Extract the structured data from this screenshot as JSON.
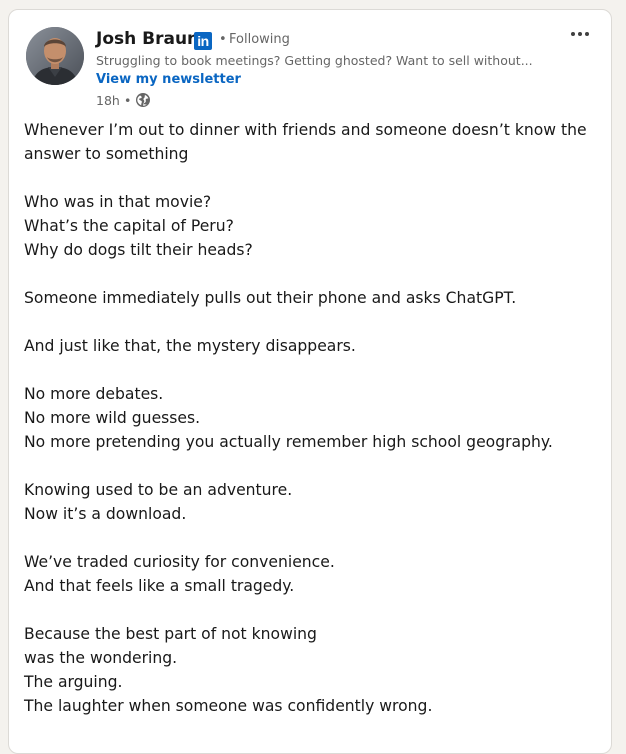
{
  "post": {
    "author": {
      "name": "Josh Braun",
      "badge": "in",
      "follow_status": "Following",
      "headline": "Struggling to book meetings? Getting ghosted? Want to sell without...",
      "newsletter_link": "View my newsletter",
      "timestamp": "18h",
      "visibility_icon": "globe-icon"
    },
    "menu_icon": "more-horizontal-icon",
    "body": [
      "Whenever I’m out to dinner with friends and someone doesn’t know the answer to something",
      "",
      "Who was in that movie?",
      "What’s the capital of Peru?",
      "Why do dogs tilt their heads?",
      "",
      "Someone immediately pulls out their phone and asks ChatGPT.",
      "",
      "And just like that, the mystery disappears.",
      "",
      "No more debates.",
      "No more wild guesses.",
      "No more pretending you actually remember high school geography.",
      "",
      "Knowing used to be an adventure.",
      "Now it’s a download.",
      "",
      "We’ve traded curiosity for convenience.",
      "And that feels like a small tragedy.",
      "",
      "Because the best part of not knowing",
      "was the wondering.",
      "The arguing.",
      "The laughter when someone was confidently wrong."
    ]
  },
  "colors": {
    "brand": "#0a66c2",
    "text": "#191919",
    "muted": "#666666",
    "page_bg": "#f4f2ee"
  }
}
